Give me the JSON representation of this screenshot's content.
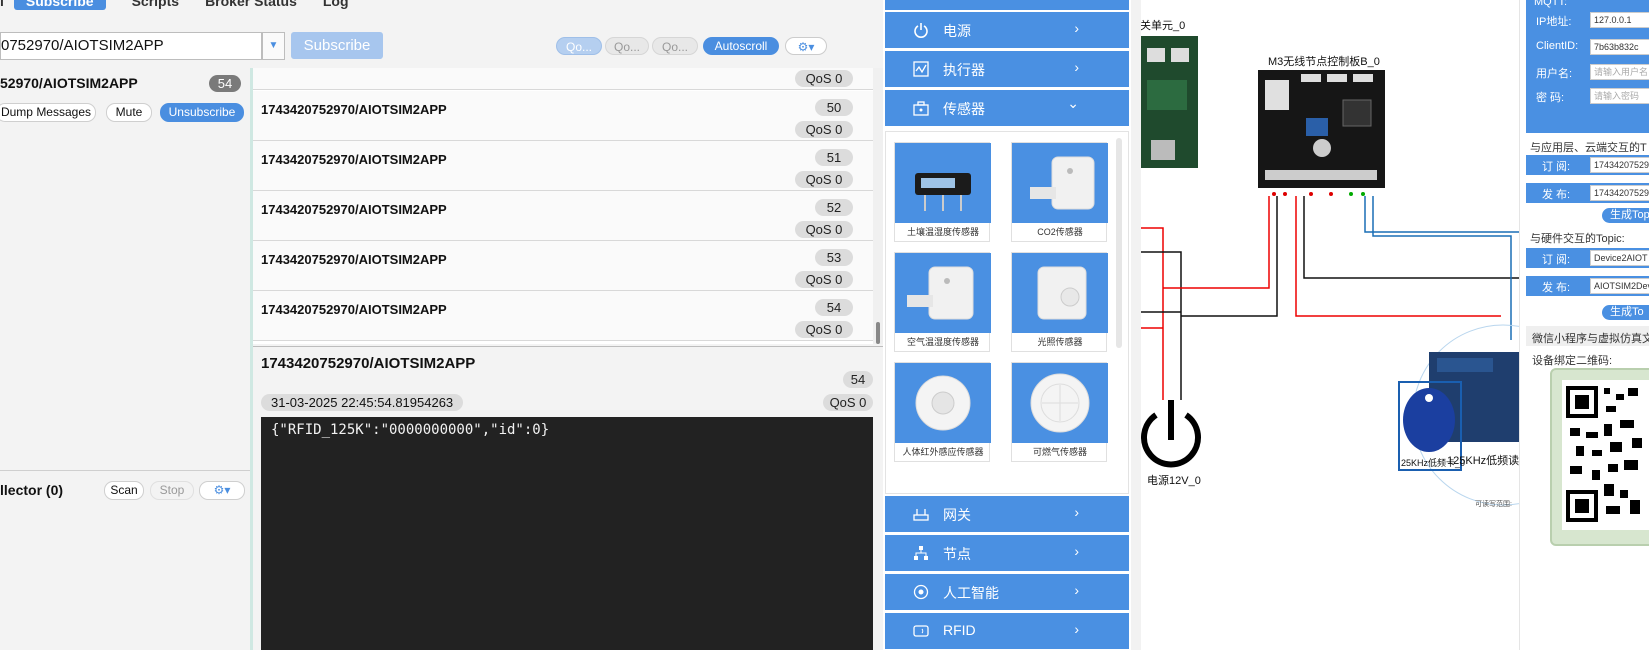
{
  "mqtt": {
    "tabs": [
      "l",
      "Subscribe",
      "Scripts",
      "Broker Status",
      "Log"
    ],
    "topic_input": "0752970/AIOTSIM2APP",
    "subscribe_button": "Subscribe",
    "qos_buttons": [
      "Qo...",
      "Qo...",
      "Qo..."
    ],
    "autoscroll": "Autoscroll",
    "subscription": {
      "topic": "52970/AIOTSIM2APP",
      "count": "54",
      "dump": "Dump Messages",
      "mute": "Mute",
      "unsubscribe": "Unsubscribe"
    },
    "collector": {
      "label": "llector (0)",
      "scan": "Scan",
      "stop": "Stop"
    },
    "messages": [
      {
        "topic": "",
        "num": "",
        "qos": "QoS 0"
      },
      {
        "topic": "1743420752970/AIOTSIM2APP",
        "num": "50",
        "qos": "QoS 0"
      },
      {
        "topic": "1743420752970/AIOTSIM2APP",
        "num": "51",
        "qos": "QoS 0"
      },
      {
        "topic": "1743420752970/AIOTSIM2APP",
        "num": "52",
        "qos": "QoS 0"
      },
      {
        "topic": "1743420752970/AIOTSIM2APP",
        "num": "53",
        "qos": "QoS 0"
      },
      {
        "topic": "1743420752970/AIOTSIM2APP",
        "num": "54",
        "qos": "QoS 0"
      }
    ],
    "detail": {
      "topic": "1743420752970/AIOTSIM2APP",
      "num": "54",
      "timestamp": "31-03-2025  22:45:54.81954263",
      "qos": "QoS 0",
      "payload": "{\"RFID_125K\":\"0000000000\",\"id\":0}"
    }
  },
  "menu": {
    "items": [
      {
        "label": "电源",
        "icon": "power-icon",
        "arrow": "›"
      },
      {
        "label": "执行器",
        "icon": "actuator-icon",
        "arrow": "›"
      },
      {
        "label": "传感器",
        "icon": "sensor-icon",
        "arrow": "⌄"
      },
      {
        "label": "网关",
        "icon": "gateway-icon",
        "arrow": "›"
      },
      {
        "label": "节点",
        "icon": "node-icon",
        "arrow": "›"
      },
      {
        "label": "人工智能",
        "icon": "ai-icon",
        "arrow": "›"
      },
      {
        "label": "RFID",
        "icon": "rfid-icon",
        "arrow": "›"
      }
    ],
    "sensors": [
      "土壤温湿度传感器",
      "CO2传感器",
      "空气温湿度传感器",
      "光照传感器",
      "人体红外感应传感器",
      "可燃气传感器"
    ]
  },
  "canvas": {
    "labels": {
      "switch_unit": "关单元_0",
      "board": "M3无线节点控制板B_0",
      "power": "电源12V_0",
      "rfid_tag": "25KHz低频卡_0",
      "rfid_reader": "125KHz低频读",
      "rfid_tag_small": "可读写范围:"
    }
  },
  "right_panel": {
    "mqtt_title": "MQTT:",
    "ip_label": "IP地址:",
    "ip_value": "127.0.0.1",
    "client_label": "ClientID:",
    "client_value": "7b63b832c",
    "user_label": "用户名:",
    "user_placeholder": "请输入用户名",
    "pwd_label": "密  码:",
    "pwd_placeholder": "请输入密码",
    "app_topic_title": "与应用层、云端交互的T",
    "sub_label": "订 阅:",
    "sub_value": "17434207529",
    "pub_label": "发 布:",
    "pub_value": "17434207529",
    "gen_topic": "生成Top",
    "hw_topic_title": "与硬件交互的Topic:",
    "hw_sub_label": "订 阅:",
    "hw_sub_value": "Device2AIOT",
    "hw_pub_label": "发 布:",
    "hw_pub_value": "AIOTSIM2Dev",
    "gen_topic2": "生成To",
    "wechat_title": "微信小程序与虚拟仿真文",
    "qr_label": "设备绑定二维码:"
  }
}
